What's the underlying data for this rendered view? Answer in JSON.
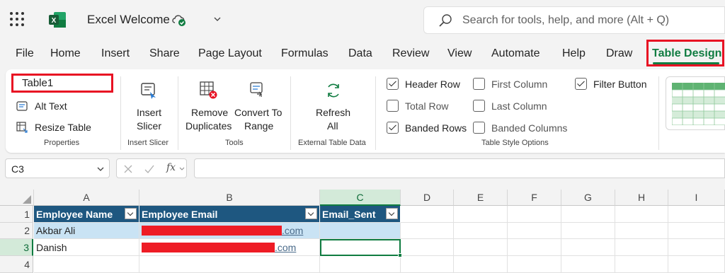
{
  "app": {
    "title": "Excel Welcome"
  },
  "search": {
    "placeholder": "Search for tools, help, and more (Alt + Q)"
  },
  "menu": {
    "tabs": [
      {
        "label": "File"
      },
      {
        "label": "Home"
      },
      {
        "label": "Insert"
      },
      {
        "label": "Share"
      },
      {
        "label": "Page Layout"
      },
      {
        "label": "Formulas"
      },
      {
        "label": "Data"
      },
      {
        "label": "Review"
      },
      {
        "label": "View"
      },
      {
        "label": "Automate"
      },
      {
        "label": "Help"
      },
      {
        "label": "Draw"
      },
      {
        "label": "Table Design",
        "active": true
      }
    ]
  },
  "ribbon": {
    "properties": {
      "table_name": "Table1",
      "alt_text": "Alt Text",
      "resize_table": "Resize Table",
      "group": "Properties"
    },
    "insert_slicer": {
      "line1": "Insert",
      "line2": "Slicer",
      "group": "Insert Slicer"
    },
    "tools": {
      "remove_line1": "Remove",
      "remove_line2": "Duplicates",
      "convert_line1": "Convert To",
      "convert_line2": "Range",
      "group": "Tools"
    },
    "external": {
      "refresh_line1": "Refresh",
      "refresh_line2": "All",
      "group": "External Table Data"
    },
    "style_options": {
      "group": "Table Style Options",
      "header_row": {
        "label": "Header Row",
        "checked": true
      },
      "total_row": {
        "label": "Total Row",
        "checked": false
      },
      "banded_rows": {
        "label": "Banded Rows",
        "checked": true
      },
      "first_column": {
        "label": "First Column",
        "checked": false
      },
      "last_column": {
        "label": "Last Column",
        "checked": false
      },
      "banded_columns": {
        "label": "Banded Columns",
        "checked": false
      },
      "filter_button": {
        "label": "Filter Button",
        "checked": true
      }
    }
  },
  "formula_bar": {
    "name_box": "C3",
    "fx": "fx",
    "formula": ""
  },
  "grid": {
    "columns": [
      "A",
      "B",
      "C",
      "D",
      "E",
      "F",
      "G",
      "H",
      "I"
    ],
    "rows": [
      "1",
      "2",
      "3",
      "4"
    ],
    "headers": [
      "Employee Name",
      "Employee Email",
      "Email_Sent"
    ],
    "data": [
      {
        "name": "Akbar Ali",
        "email_suffix": ".com",
        "sent": ""
      },
      {
        "name": "Danish",
        "email_suffix": ".com",
        "sent": ""
      }
    ],
    "active_cell": "C3"
  },
  "colors": {
    "accent": "#107c41",
    "table_header": "#1e5780",
    "band": "#c9e3f4",
    "highlight": "#e81123"
  }
}
